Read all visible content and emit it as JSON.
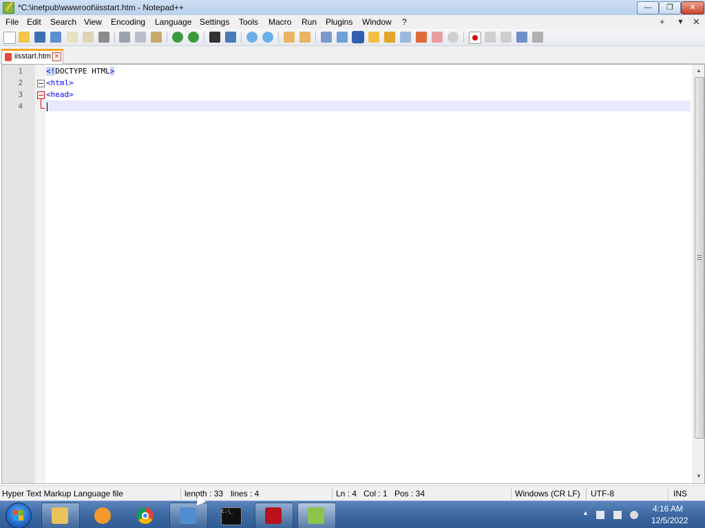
{
  "window": {
    "title": "*C:\\inetpub\\wwwroot\\iisstart.htm - Notepad++",
    "min_label": "—",
    "max_label": "❐",
    "close_label": "✕"
  },
  "menu": {
    "items": [
      "File",
      "Edit",
      "Search",
      "View",
      "Encoding",
      "Language",
      "Settings",
      "Tools",
      "Macro",
      "Run",
      "Plugins",
      "Window",
      "?"
    ],
    "right_plus": "+",
    "right_down": "▼",
    "right_close": "✕"
  },
  "toolbar": {
    "icons": [
      "new-file-icon",
      "open-file-icon",
      "save-icon",
      "save-all-icon",
      "close-icon",
      "close-all-icon",
      "print-icon",
      "cut-icon",
      "copy-icon",
      "paste-icon",
      "undo-icon",
      "redo-icon",
      "find-icon",
      "replace-icon",
      "zoom-in-icon",
      "zoom-out-icon",
      "sync-vertical-icon",
      "sync-horizontal-icon",
      "word-wrap-icon",
      "show-all-chars-icon",
      "indent-guide-icon",
      "user-language-icon",
      "document-map-icon",
      "function-list-icon",
      "folder-as-workspace-icon",
      "monitoring-icon",
      "record-macro-icon",
      "stop-recording-icon",
      "play-macro-icon",
      "run-macro-multiple-icon",
      "save-macro-icon"
    ]
  },
  "tab": {
    "label": "iisstart.htm",
    "close_label": "✕"
  },
  "editor": {
    "line_numbers": [
      "1",
      "2",
      "3",
      "4"
    ],
    "lines": {
      "l1_open": "<!",
      "l1_rest": "DOCTYPE HTML",
      "l1_close": ">",
      "l2": "<html>",
      "l3": "<head>"
    }
  },
  "scrollbar": {
    "up": "▲",
    "down": "▼"
  },
  "status": {
    "file_type": "Hyper Text Markup Language file",
    "length": "length : 33",
    "lines": "lines : 4",
    "ln": "Ln : 4",
    "col": "Col : 1",
    "pos": "Pos : 34",
    "eol": "Windows (CR LF)",
    "encoding": "UTF-8",
    "mode": "INS"
  },
  "taskbar": {
    "apps": [
      "windows-explorer",
      "media-player",
      "chrome",
      "iis-manager",
      "command-prompt",
      "filezilla",
      "notepad-plus-plus"
    ],
    "cmd_label": "C:\\_",
    "time": "4:16 AM",
    "date": "12/5/2022",
    "tray_arrow": "▲"
  }
}
